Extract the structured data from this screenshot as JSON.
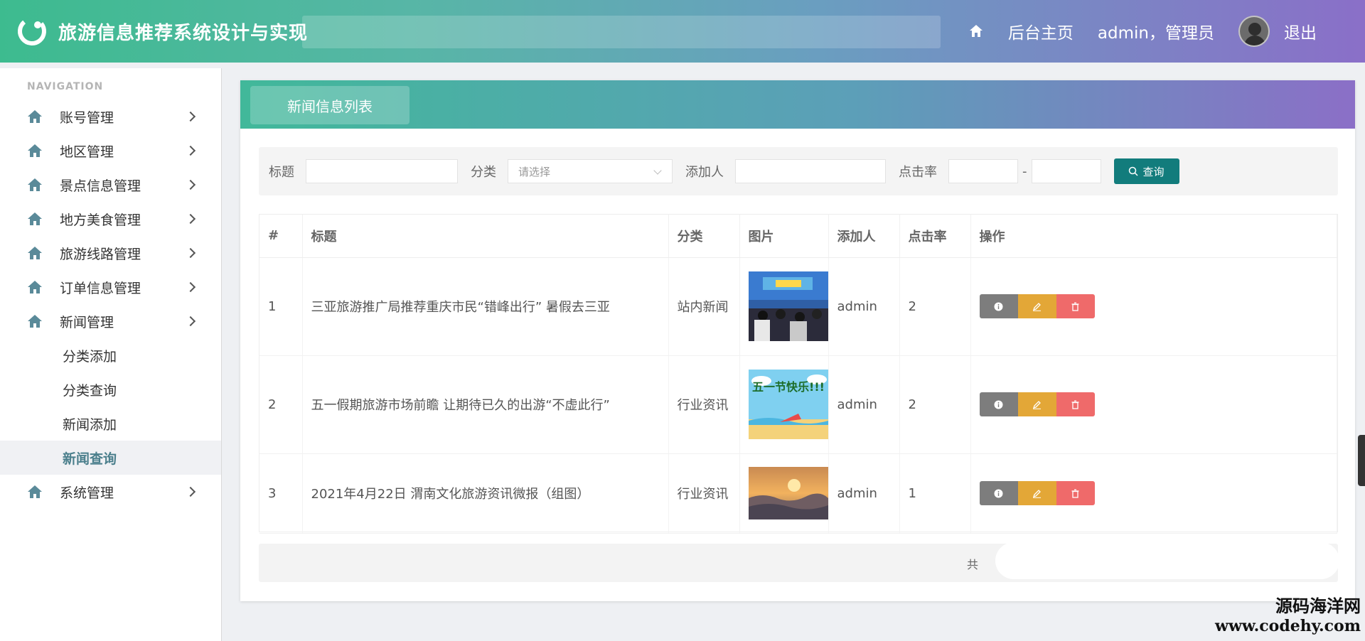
{
  "app": {
    "title": "旅游信息推荐系统设计与实现"
  },
  "header": {
    "home_label": "后台主页",
    "user_label": "admin，管理员",
    "logout_label": "退出"
  },
  "sidebar": {
    "nav_label": "NAVIGATION",
    "items": [
      {
        "label": "账号管理"
      },
      {
        "label": "地区管理"
      },
      {
        "label": "景点信息管理"
      },
      {
        "label": "地方美食管理"
      },
      {
        "label": "旅游线路管理"
      },
      {
        "label": "订单信息管理"
      },
      {
        "label": "新闻管理"
      },
      {
        "label": "系统管理"
      }
    ],
    "news_sub": [
      {
        "label": "分类添加"
      },
      {
        "label": "分类查询"
      },
      {
        "label": "新闻添加"
      },
      {
        "label": "新闻查询",
        "active": true
      }
    ]
  },
  "panel": {
    "tab_label": "新闻信息列表"
  },
  "search": {
    "title_label": "标题",
    "category_label": "分类",
    "category_placeholder": "请选择",
    "adder_label": "添加人",
    "clicks_label": "点击率",
    "range_sep": "-",
    "button_label": "查询"
  },
  "table": {
    "headers": [
      "#",
      "标题",
      "分类",
      "图片",
      "添加人",
      "点击率",
      "操作"
    ],
    "rows": [
      {
        "no": "1",
        "title": "三亚旅游推广局推荐重庆市民“错峰出行” 暑假去三亚",
        "category": "站内新闻",
        "adder": "admin",
        "clicks": "2",
        "image": "event-crowd-photo"
      },
      {
        "no": "2",
        "title": "五一假期旅游市场前瞻 让期待已久的出游“不虚此行”",
        "category": "行业资讯",
        "adder": "admin",
        "clicks": "2",
        "image": "may-day-beach-cartoon",
        "image_text": "五一节快乐!!!"
      },
      {
        "no": "3",
        "title": "2021年4月22日 渭南文化旅游资讯微报（组图）",
        "category": "行业资讯",
        "adder": "admin",
        "clicks": "1",
        "image": "sunrise-clouds-photo"
      }
    ]
  },
  "pager": {
    "total_prefix": "共"
  },
  "watermark": {
    "line1": "源码海洋网",
    "line2": "www.codehy.com"
  },
  "colors": {
    "header_start": "#3dbb8f",
    "header_end": "#8a6fc8",
    "search_button": "#127c7c",
    "info_button": "#7d7d7d",
    "edit_button": "#e3a737",
    "delete_button": "#ef6a6a"
  }
}
